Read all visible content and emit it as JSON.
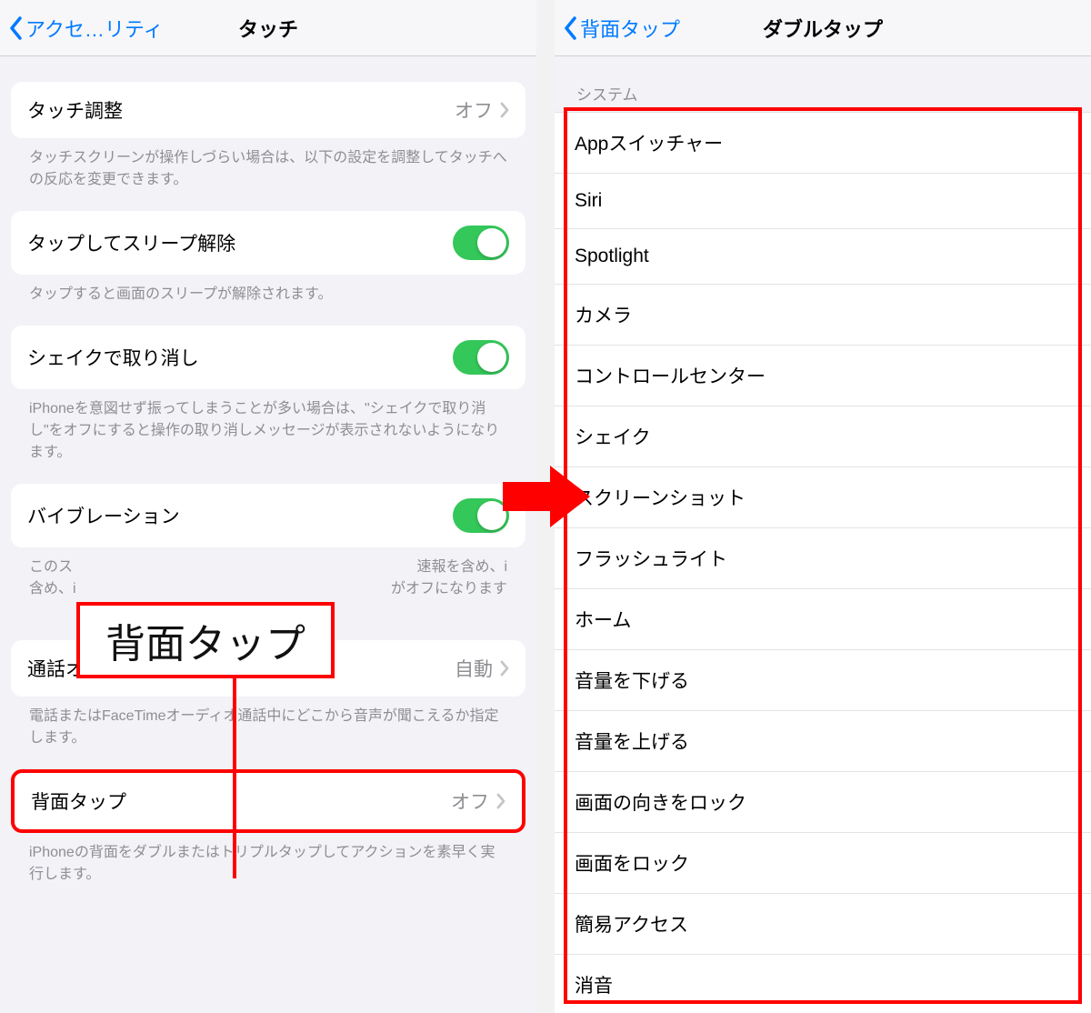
{
  "left": {
    "back_label": "アクセ…リティ",
    "title": "タッチ",
    "rows": {
      "touch_accommodations": {
        "label": "タッチ調整",
        "value": "オフ"
      },
      "touch_accommodations_caption": "タッチスクリーンが操作しづらい場合は、以下の設定を調整してタッチへの反応を変更できます。",
      "tap_to_wake": {
        "label": "タップしてスリープ解除"
      },
      "tap_to_wake_caption": "タップすると画面のスリープが解除されます。",
      "shake_undo": {
        "label": "シェイクで取り消し"
      },
      "shake_undo_caption": "iPhoneを意図せず振ってしまうことが多い場合は、\"シェイクで取り消し\"をオフにすると操作の取り消しメッセージが表示されないようになります。",
      "vibration": {
        "label": "バイブレーション"
      },
      "vibration_caption_a": "このス",
      "vibration_caption_b": "速報を含め、i",
      "vibration_caption_c": "がオフになります",
      "call_audio": {
        "label": "通話オーディオルーティング",
        "value": "自動"
      },
      "call_audio_caption": "電話またはFaceTimeオーディオ通話中にどこから音声が聞こえるか指定します。",
      "back_tap": {
        "label": "背面タップ",
        "value": "オフ"
      },
      "back_tap_caption": "iPhoneの背面をダブルまたはトリプルタップしてアクションを素早く実行します。"
    },
    "callout_label": "背面タップ"
  },
  "right": {
    "back_label": "背面タップ",
    "title": "ダブルタップ",
    "section_header": "システム",
    "items": [
      "Appスイッチャー",
      "Siri",
      "Spotlight",
      "カメラ",
      "コントロールセンター",
      "シェイク",
      "スクリーンショット",
      "フラッシュライト",
      "ホーム",
      "音量を下げる",
      "音量を上げる",
      "画面の向きをロック",
      "画面をロック",
      "簡易アクセス",
      "消音"
    ]
  },
  "colors": {
    "accent": "#007aff",
    "toggle_on": "#34c759",
    "highlight": "#ff0000"
  }
}
